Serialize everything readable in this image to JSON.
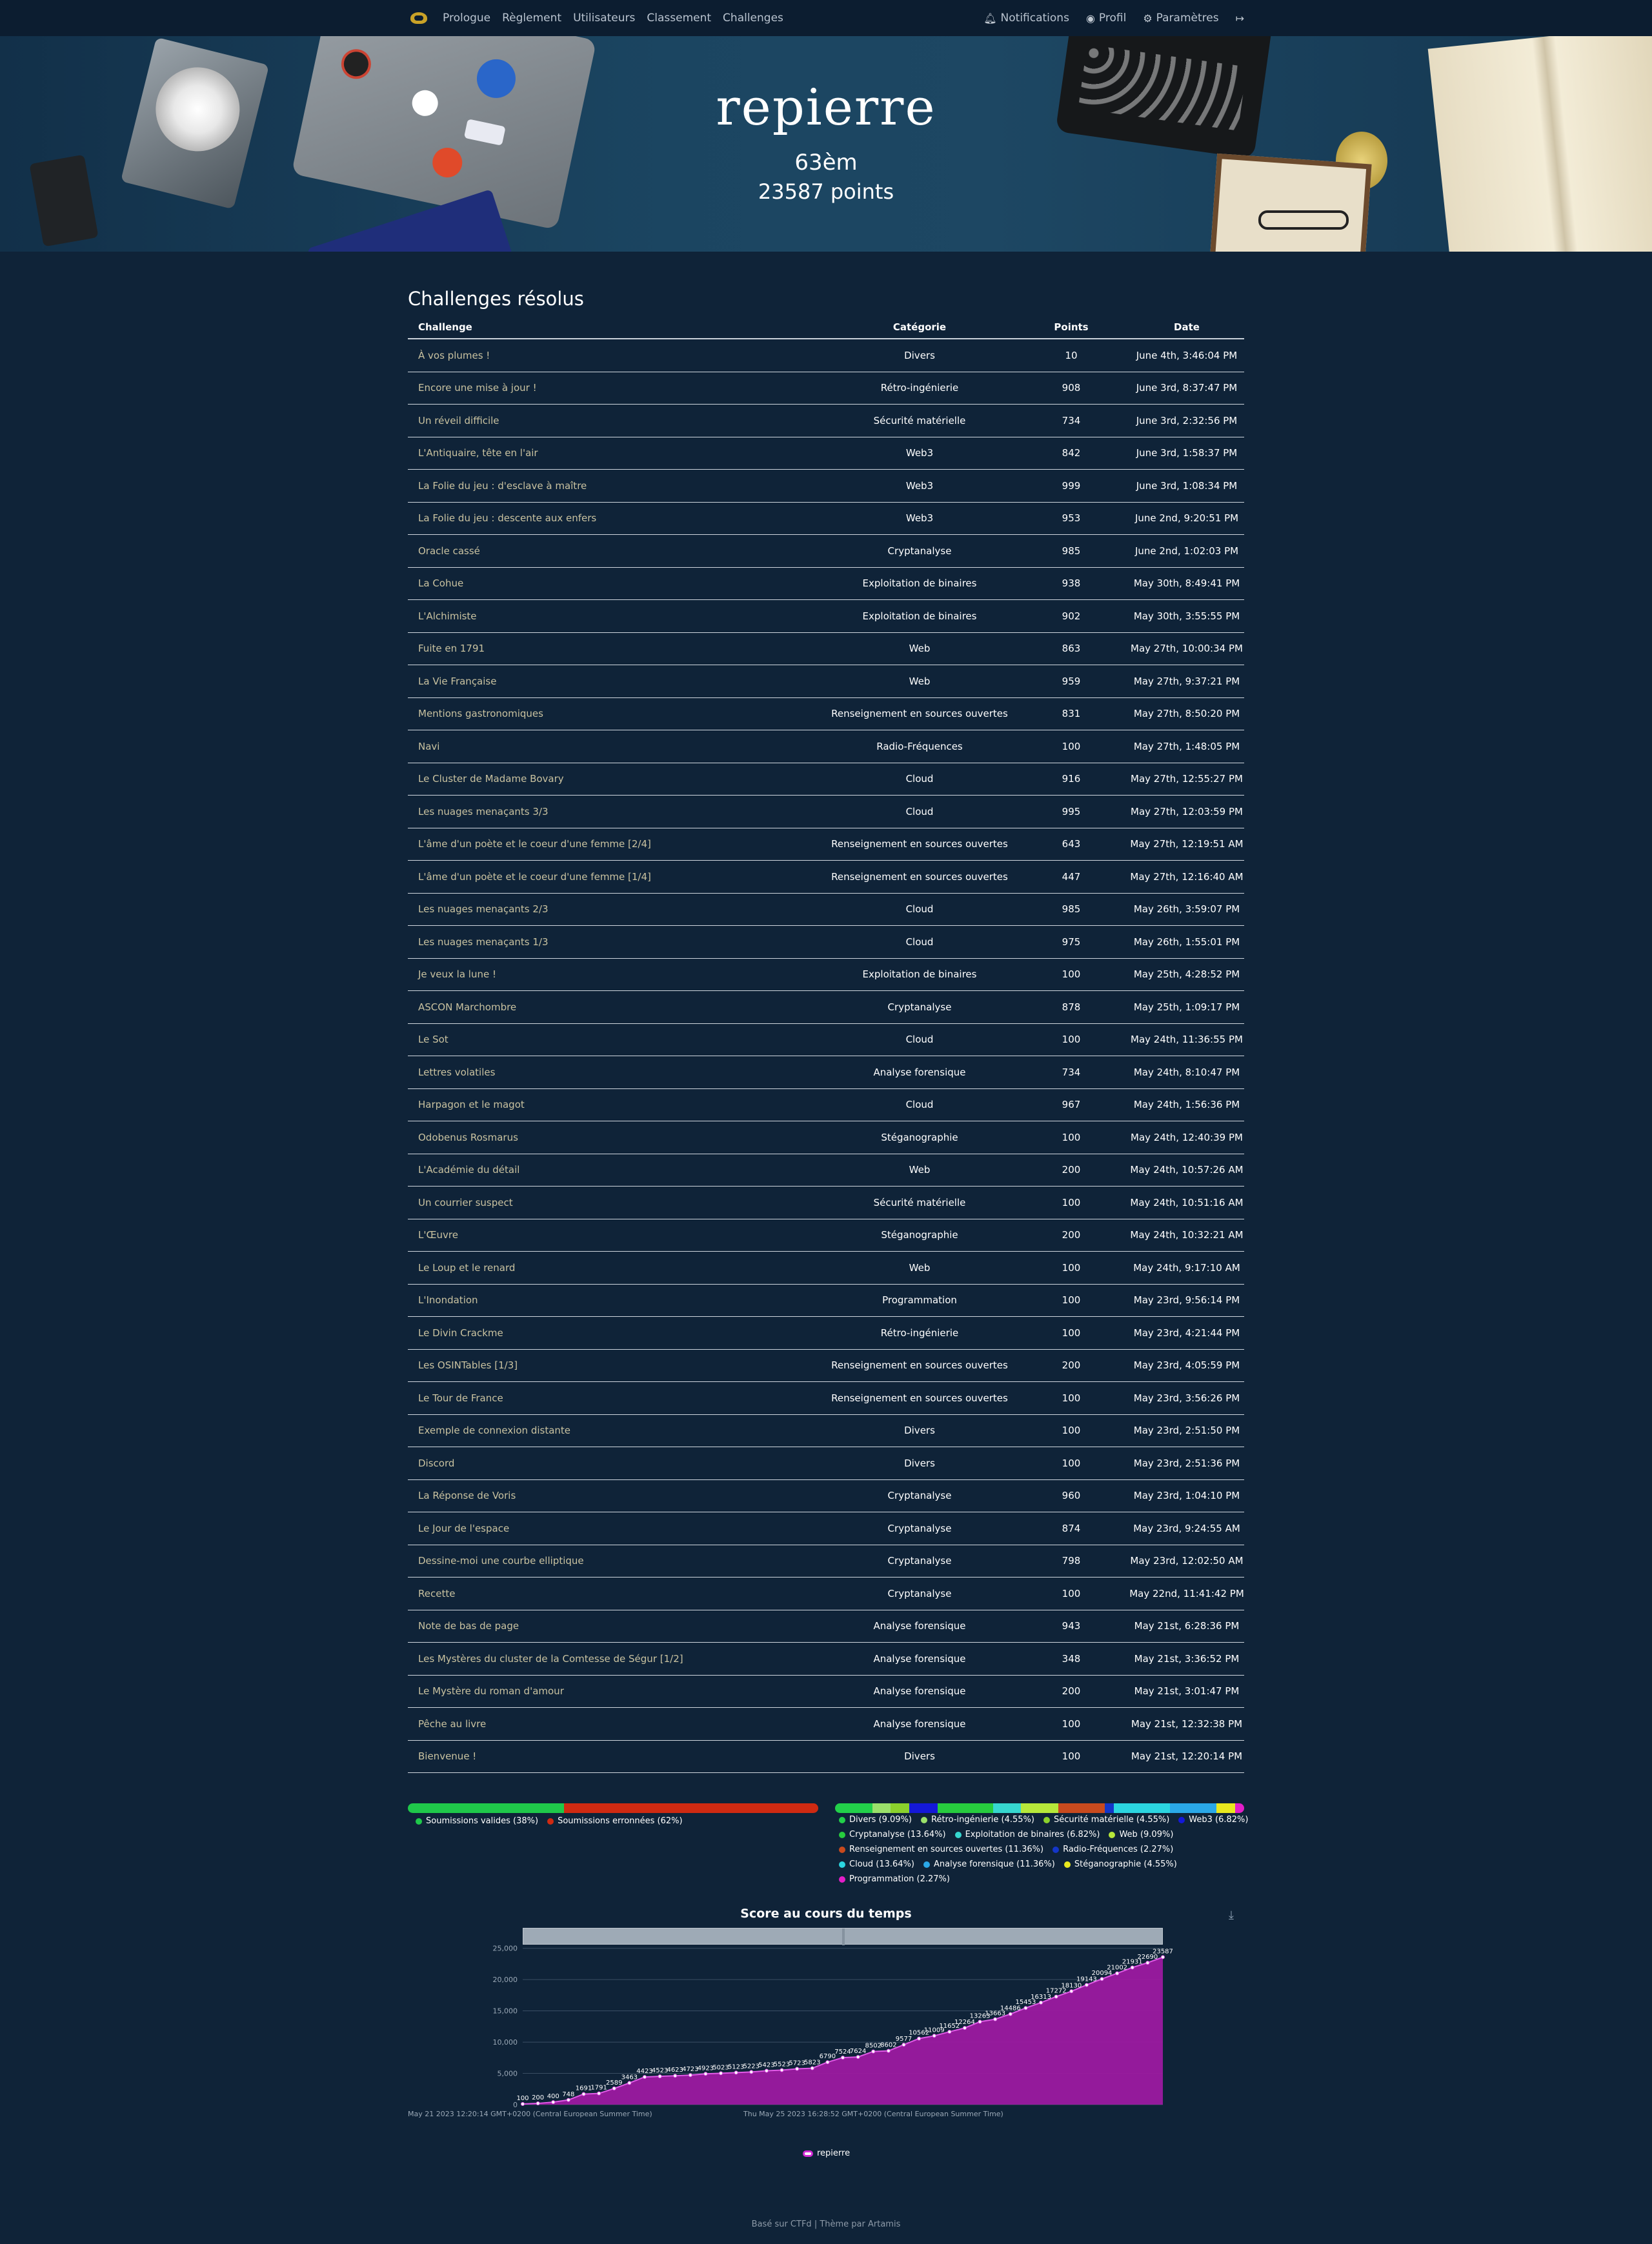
{
  "nav": {
    "left": [
      "Prologue",
      "Règlement",
      "Utilisateurs",
      "Classement",
      "Challenges"
    ],
    "notifications": "Notifications",
    "profile": "Profil",
    "settings": "Paramètres"
  },
  "hero": {
    "username": "repierre",
    "rank": "63èm",
    "points": "23587 points"
  },
  "solved": {
    "title": "Challenges résolus",
    "headers": [
      "Challenge",
      "Catégorie",
      "Points",
      "Date"
    ],
    "rows": [
      [
        "À vos plumes !",
        "Divers",
        "10",
        "June 4th, 3:46:04 PM"
      ],
      [
        "Encore une mise à jour !",
        "Rétro-ingénierie",
        "908",
        "June 3rd, 8:37:47 PM"
      ],
      [
        "Un réveil difficile",
        "Sécurité matérielle",
        "734",
        "June 3rd, 2:32:56 PM"
      ],
      [
        "L'Antiquaire, tête en l'air",
        "Web3",
        "842",
        "June 3rd, 1:58:37 PM"
      ],
      [
        "La Folie du jeu : d'esclave à maître",
        "Web3",
        "999",
        "June 3rd, 1:08:34 PM"
      ],
      [
        "La Folie du jeu : descente aux enfers",
        "Web3",
        "953",
        "June 2nd, 9:20:51 PM"
      ],
      [
        "Oracle cassé",
        "Cryptanalyse",
        "985",
        "June 2nd, 1:02:03 PM"
      ],
      [
        "La Cohue",
        "Exploitation de binaires",
        "938",
        "May 30th, 8:49:41 PM"
      ],
      [
        "L'Alchimiste",
        "Exploitation de binaires",
        "902",
        "May 30th, 3:55:55 PM"
      ],
      [
        "Fuite en 1791",
        "Web",
        "863",
        "May 27th, 10:00:34 PM"
      ],
      [
        "La Vie Française",
        "Web",
        "959",
        "May 27th, 9:37:21 PM"
      ],
      [
        "Mentions gastronomiques",
        "Renseignement en sources ouvertes",
        "831",
        "May 27th, 8:50:20 PM"
      ],
      [
        "Navi",
        "Radio-Fréquences",
        "100",
        "May 27th, 1:48:05 PM"
      ],
      [
        "Le Cluster de Madame Bovary",
        "Cloud",
        "916",
        "May 27th, 12:55:27 PM"
      ],
      [
        "Les nuages menaçants 3/3",
        "Cloud",
        "995",
        "May 27th, 12:03:59 PM"
      ],
      [
        "L'âme d'un poète et le coeur d'une femme [2/4]",
        "Renseignement en sources ouvertes",
        "643",
        "May 27th, 12:19:51 AM"
      ],
      [
        "L'âme d'un poète et le coeur d'une femme [1/4]",
        "Renseignement en sources ouvertes",
        "447",
        "May 27th, 12:16:40 AM"
      ],
      [
        "Les nuages menaçants 2/3",
        "Cloud",
        "985",
        "May 26th, 3:59:07 PM"
      ],
      [
        "Les nuages menaçants 1/3",
        "Cloud",
        "975",
        "May 26th, 1:55:01 PM"
      ],
      [
        "Je veux la lune !",
        "Exploitation de binaires",
        "100",
        "May 25th, 4:28:52 PM"
      ],
      [
        "ASCON Marchombre",
        "Cryptanalyse",
        "878",
        "May 25th, 1:09:17 PM"
      ],
      [
        "Le Sot",
        "Cloud",
        "100",
        "May 24th, 11:36:55 PM"
      ],
      [
        "Lettres volatiles",
        "Analyse forensique",
        "734",
        "May 24th, 8:10:47 PM"
      ],
      [
        "Harpagon et le magot",
        "Cloud",
        "967",
        "May 24th, 1:56:36 PM"
      ],
      [
        "Odobenus Rosmarus",
        "Stéganographie",
        "100",
        "May 24th, 12:40:39 PM"
      ],
      [
        "L'Académie du détail",
        "Web",
        "200",
        "May 24th, 10:57:26 AM"
      ],
      [
        "Un courrier suspect",
        "Sécurité matérielle",
        "100",
        "May 24th, 10:51:16 AM"
      ],
      [
        "L'Œuvre",
        "Stéganographie",
        "200",
        "May 24th, 10:32:21 AM"
      ],
      [
        "Le Loup et le renard",
        "Web",
        "100",
        "May 24th, 9:17:10 AM"
      ],
      [
        "L'Inondation",
        "Programmation",
        "100",
        "May 23rd, 9:56:14 PM"
      ],
      [
        "Le Divin Crackme",
        "Rétro-ingénierie",
        "100",
        "May 23rd, 4:21:44 PM"
      ],
      [
        "Les OSINTables [1/3]",
        "Renseignement en sources ouvertes",
        "200",
        "May 23rd, 4:05:59 PM"
      ],
      [
        "Le Tour de France",
        "Renseignement en sources ouvertes",
        "100",
        "May 23rd, 3:56:26 PM"
      ],
      [
        "Exemple de connexion distante",
        "Divers",
        "100",
        "May 23rd, 2:51:50 PM"
      ],
      [
        "Discord",
        "Divers",
        "100",
        "May 23rd, 2:51:36 PM"
      ],
      [
        "La Réponse de Voris",
        "Cryptanalyse",
        "960",
        "May 23rd, 1:04:10 PM"
      ],
      [
        "Le Jour de l'espace",
        "Cryptanalyse",
        "874",
        "May 23rd, 9:24:55 AM"
      ],
      [
        "Dessine-moi une courbe elliptique",
        "Cryptanalyse",
        "798",
        "May 23rd, 12:02:50 AM"
      ],
      [
        "Recette",
        "Cryptanalyse",
        "100",
        "May 22nd, 11:41:42 PM"
      ],
      [
        "Note de bas de page",
        "Analyse forensique",
        "943",
        "May 21st, 6:28:36 PM"
      ],
      [
        "Les Mystères du cluster de la Comtesse de Ségur [1/2]",
        "Analyse forensique",
        "348",
        "May 21st, 3:36:52 PM"
      ],
      [
        "Le Mystère du roman d'amour",
        "Analyse forensique",
        "200",
        "May 21st, 3:01:47 PM"
      ],
      [
        "Pêche au livre",
        "Analyse forensique",
        "100",
        "May 21st, 12:32:38 PM"
      ],
      [
        "Bienvenue !",
        "Divers",
        "100",
        "May 21st, 12:20:14 PM"
      ]
    ]
  },
  "submissions": [
    {
      "label": "Soumissions valides (38%)",
      "pct": 38,
      "color": "#1fc84a"
    },
    {
      "label": "Soumissions erronnées (62%)",
      "pct": 62,
      "color": "#cf2a12"
    }
  ],
  "categories": [
    {
      "label": "Divers (9.09%)",
      "pct": 9.09,
      "color": "#22d04a"
    },
    {
      "label": "Rétro-ingénierie (4.55%)",
      "pct": 4.55,
      "color": "#9ae06a"
    },
    {
      "label": "Sécurité matérielle (4.55%)",
      "pct": 4.55,
      "color": "#8bd12c"
    },
    {
      "label": "Web3 (6.82%)",
      "pct": 6.82,
      "color": "#1418d8"
    },
    {
      "label": "Cryptanalyse (13.64%)",
      "pct": 13.64,
      "color": "#27cc3e"
    },
    {
      "label": "Exploitation de binaires (6.82%)",
      "pct": 6.82,
      "color": "#36d7cf"
    },
    {
      "label": "Web (9.09%)",
      "pct": 9.09,
      "color": "#b7e83a"
    },
    {
      "label": "Renseignement en sources ouvertes (11.36%)",
      "pct": 11.36,
      "color": "#c84a1e"
    },
    {
      "label": "Radio-Fréquences (2.27%)",
      "pct": 2.27,
      "color": "#1436c8"
    },
    {
      "label": "Cloud (13.64%)",
      "pct": 13.64,
      "color": "#2bd5e0"
    },
    {
      "label": "Analyse forensique (11.36%)",
      "pct": 11.36,
      "color": "#2aa8e8"
    },
    {
      "label": "Stéganographie (4.55%)",
      "pct": 4.55,
      "color": "#e8e81e"
    },
    {
      "label": "Programmation (2.27%)",
      "pct": 2.27,
      "color": "#e21ec8"
    }
  ],
  "chart": {
    "title": "Score au cours du temps",
    "legend": "repierre",
    "x_start_label": "May 21 2023 12:20:14 GMT+0200 (Central European Summer Time)",
    "x_mid_label": "Thu May 25 2023 16:28:52 GMT+0200 (Central European Summer Time)",
    "series_color": "#9c1aa0",
    "line_color": "#e05ae6"
  },
  "chart_data": {
    "type": "area",
    "title": "Score au cours du temps",
    "series": [
      {
        "name": "repierre",
        "values": [
          100,
          200,
          400,
          748,
          1691,
          1791,
          2589,
          3463,
          4423,
          4523,
          4623,
          4723,
          4923,
          5023,
          5123,
          5223,
          5423,
          5523,
          5723,
          5823,
          6790,
          7524,
          7624,
          8502,
          8602,
          9577,
          10562,
          11009,
          11652,
          12264,
          13263,
          13663,
          14486,
          15453,
          16313,
          17272,
          18130,
          19143,
          20094,
          21002,
          21931,
          22690,
          23587
        ]
      }
    ],
    "ylim": [
      0,
      26000
    ],
    "yticks": [
      "0",
      "5,000",
      "10,000",
      "15,000",
      "20,000",
      "25,000"
    ],
    "grid": true,
    "legend_position": "bottom"
  },
  "footer": "Basé sur CTFd | Thème par Artamis"
}
